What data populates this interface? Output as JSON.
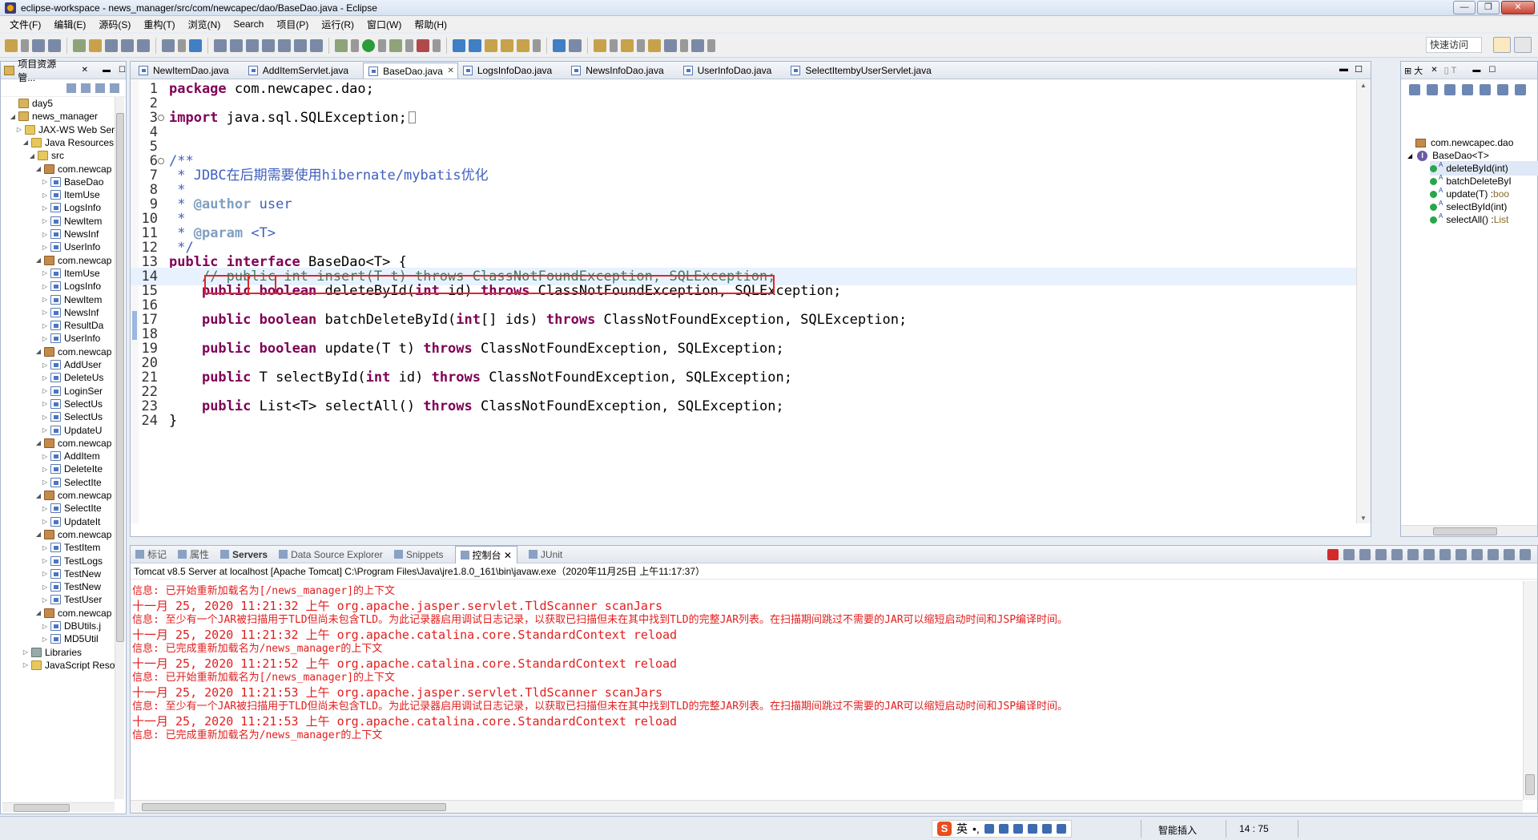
{
  "window": {
    "title": "eclipse-workspace - news_manager/src/com/newcapec/dao/BaseDao.java - Eclipse",
    "controls": [
      "—",
      "❐",
      "✕"
    ]
  },
  "menu": [
    "文件(F)",
    "编辑(E)",
    "源码(S)",
    "重构(T)",
    "浏览(N)",
    "Search",
    "项目(P)",
    "运行(R)",
    "窗口(W)",
    "帮助(H)"
  ],
  "quick_access": "快速访问",
  "project_explorer": {
    "title": "项目资源管...",
    "nodes": [
      {
        "label": "day5",
        "icon": "project-icon",
        "twisty": ""
      },
      {
        "label": "news_manager",
        "icon": "project-icon",
        "twisty": "◢"
      },
      {
        "label": "JAX-WS Web Serv",
        "icon": "folder-icon",
        "twisty": "▷"
      },
      {
        "label": "Java Resources",
        "icon": "folder-icon",
        "twisty": "◢"
      },
      {
        "label": "src",
        "icon": "folder-icon",
        "twisty": "◢"
      },
      {
        "label": "com.newcap",
        "icon": "package-icon",
        "twisty": "◢"
      },
      {
        "label": "BaseDao",
        "icon": "java-file-icon",
        "twisty": "▷"
      },
      {
        "label": "ItemUse",
        "icon": "java-file-icon",
        "twisty": "▷"
      },
      {
        "label": "LogsInfo",
        "icon": "java-file-icon",
        "twisty": "▷"
      },
      {
        "label": "NewItem",
        "icon": "java-file-icon",
        "twisty": "▷"
      },
      {
        "label": "NewsInf",
        "icon": "java-file-icon",
        "twisty": "▷"
      },
      {
        "label": "UserInfo",
        "icon": "java-file-icon",
        "twisty": "▷"
      },
      {
        "label": "com.newcap",
        "icon": "package-icon",
        "twisty": "◢"
      },
      {
        "label": "ItemUse",
        "icon": "java-file-icon",
        "twisty": "▷"
      },
      {
        "label": "LogsInfo",
        "icon": "java-file-icon",
        "twisty": "▷"
      },
      {
        "label": "NewItem",
        "icon": "java-file-icon",
        "twisty": "▷"
      },
      {
        "label": "NewsInf",
        "icon": "java-file-icon",
        "twisty": "▷"
      },
      {
        "label": "ResultDa",
        "icon": "java-file-icon",
        "twisty": "▷"
      },
      {
        "label": "UserInfo",
        "icon": "java-file-icon",
        "twisty": "▷"
      },
      {
        "label": "com.newcap",
        "icon": "package-icon",
        "twisty": "◢"
      },
      {
        "label": "AddUser",
        "icon": "java-file-icon",
        "twisty": "▷"
      },
      {
        "label": "DeleteUs",
        "icon": "java-file-icon",
        "twisty": "▷"
      },
      {
        "label": "LoginSer",
        "icon": "java-file-icon",
        "twisty": "▷"
      },
      {
        "label": "SelectUs",
        "icon": "java-file-icon",
        "twisty": "▷"
      },
      {
        "label": "SelectUs",
        "icon": "java-file-icon",
        "twisty": "▷"
      },
      {
        "label": "UpdateU",
        "icon": "java-file-icon",
        "twisty": "▷"
      },
      {
        "label": "com.newcap",
        "icon": "package-icon",
        "twisty": "◢"
      },
      {
        "label": "AddItem",
        "icon": "java-file-icon",
        "twisty": "▷"
      },
      {
        "label": "DeleteIte",
        "icon": "java-file-icon",
        "twisty": "▷"
      },
      {
        "label": "SelectIte",
        "icon": "java-file-icon",
        "twisty": "▷"
      },
      {
        "label": "com.newcap",
        "icon": "package-icon",
        "twisty": "◢"
      },
      {
        "label": "SelectIte",
        "icon": "java-file-icon",
        "twisty": "▷"
      },
      {
        "label": "UpdateIt",
        "icon": "java-file-icon",
        "twisty": "▷"
      },
      {
        "label": "com.newcap",
        "icon": "package-icon",
        "twisty": "◢"
      },
      {
        "label": "TestItem",
        "icon": "java-file-icon",
        "twisty": "▷"
      },
      {
        "label": "TestLogs",
        "icon": "java-file-icon",
        "twisty": "▷"
      },
      {
        "label": "TestNew",
        "icon": "java-file-icon",
        "twisty": "▷"
      },
      {
        "label": "TestNew",
        "icon": "java-file-icon",
        "twisty": "▷"
      },
      {
        "label": "TestUser",
        "icon": "java-file-icon",
        "twisty": "▷"
      },
      {
        "label": "com.newcap",
        "icon": "package-icon",
        "twisty": "◢"
      },
      {
        "label": "DBUtils.j",
        "icon": "java-file-icon",
        "twisty": "▷"
      },
      {
        "label": "MD5Util",
        "icon": "java-file-icon",
        "twisty": "▷"
      },
      {
        "label": "Libraries",
        "icon": "library-icon",
        "twisty": "▷"
      },
      {
        "label": "JavaScript Resour",
        "icon": "folder-icon",
        "twisty": "▷"
      }
    ]
  },
  "editor": {
    "tabs": [
      {
        "label": "NewItemDao.java",
        "active": false
      },
      {
        "label": "AddItemServlet.java",
        "active": false
      },
      {
        "label": "BaseDao.java",
        "active": true
      },
      {
        "label": "LogsInfoDao.java",
        "active": false
      },
      {
        "label": "NewsInfoDao.java",
        "active": false
      },
      {
        "label": "UserInfoDao.java",
        "active": false
      },
      {
        "label": "SelectItembyUserServlet.java",
        "active": false
      }
    ],
    "current_line": 14,
    "lines": [
      {
        "n": "1",
        "html": "<span class=\"kw\">package</span> com.newcapec.dao;"
      },
      {
        "n": "2",
        "html": ""
      },
      {
        "n": "3",
        "fold": true,
        "html": "<span class=\"kw\">import</span> java.sql.SQLException;<span style=\"display:inline-block;width:9px;height:15px;border:1px solid #888;vertical-align:-2px;margin-left:2px\"></span>"
      },
      {
        "n": "4",
        "html": ""
      },
      {
        "n": "5",
        "html": ""
      },
      {
        "n": "6",
        "fold": true,
        "html": "<span class=\"jd\">/**</span>"
      },
      {
        "n": "7",
        "html": "<span class=\"jd\"> * JDBC在后期需要使用hibernate/mybatis优化</span>"
      },
      {
        "n": "8",
        "html": "<span class=\"jd\"> *</span>"
      },
      {
        "n": "9",
        "html": "<span class=\"jd\"> * </span><span class=\"tag\">@author</span><span class=\"jd\"> user</span>"
      },
      {
        "n": "10",
        "html": "<span class=\"jd\"> *</span>"
      },
      {
        "n": "11",
        "html": "<span class=\"jd\"> * </span><span class=\"tag\">@param</span><span class=\"jd\"> &lt;T&gt;</span>"
      },
      {
        "n": "12",
        "html": "<span class=\"jd\"> */</span>"
      },
      {
        "n": "13",
        "html": "<span class=\"kw\">public</span> <span class=\"kw\">interface</span> BaseDao&lt;T&gt; {"
      },
      {
        "n": "14",
        "html": "    <span class=\"cm\">// public int insert(T t) throws ClassNotFoundException, SQLException;</span>"
      },
      {
        "n": "15",
        "html": "    <span class=\"kw\">public</span> <span class=\"kw\">boolean</span> deleteById(<span class=\"kw\">int</span> id) <span class=\"kw\">throws</span> ClassNotFoundException, SQLException;"
      },
      {
        "n": "16",
        "html": ""
      },
      {
        "n": "17",
        "html": "    <span class=\"kw\">public</span> <span class=\"kw\">boolean</span> batchDeleteById(<span class=\"kw\">int</span>[] ids) <span class=\"kw\">throws</span> ClassNotFoundException, SQLException;"
      },
      {
        "n": "18",
        "html": ""
      },
      {
        "n": "19",
        "html": "    <span class=\"kw\">public</span> <span class=\"kw\">boolean</span> update(T t) <span class=\"kw\">throws</span> ClassNotFoundException, SQLException;"
      },
      {
        "n": "20",
        "html": ""
      },
      {
        "n": "21",
        "html": "    <span class=\"kw\">public</span> T selectById(<span class=\"kw\">int</span> id) <span class=\"kw\">throws</span> ClassNotFoundException, SQLException;"
      },
      {
        "n": "22",
        "html": ""
      },
      {
        "n": "23",
        "html": "    <span class=\"kw\">public</span> List&lt;T&gt; selectAll() <span class=\"kw\">throws</span> ClassNotFoundException, SQLException;"
      },
      {
        "n": "24",
        "html": "}"
      }
    ]
  },
  "outline": {
    "items": [
      {
        "kind": "package",
        "label": "com.newcapec.dao",
        "type": ""
      },
      {
        "kind": "interface",
        "label": "BaseDao<T>",
        "type": ""
      },
      {
        "kind": "method",
        "label": "deleteById(int)",
        "type": ""
      },
      {
        "kind": "method",
        "label": "batchDeleteByI",
        "type": ""
      },
      {
        "kind": "method",
        "label": "update(T) : ",
        "type": "boo"
      },
      {
        "kind": "method",
        "label": "selectById(int)",
        "type": ""
      },
      {
        "kind": "method",
        "label": "selectAll() : ",
        "type": "List"
      }
    ]
  },
  "console": {
    "tabs": [
      {
        "label": "标记",
        "active": false,
        "bold": false
      },
      {
        "label": "属性",
        "active": false,
        "bold": false
      },
      {
        "label": "Servers",
        "active": false,
        "bold": true
      },
      {
        "label": "Data Source Explorer",
        "active": false,
        "bold": false
      },
      {
        "label": "Snippets",
        "active": false,
        "bold": false
      },
      {
        "label": "控制台 ✕",
        "active": true,
        "bold": false
      },
      {
        "label": "JUnit",
        "active": false,
        "bold": false
      }
    ],
    "process": "Tomcat v8.5 Server at localhost [Apache Tomcat] C:\\Program Files\\Java\\jre1.8.0_161\\bin\\javaw.exe（2020年11月25日 上午11:17:37）",
    "lines": [
      {
        "text": "信息: 已开始重新加载名为[/news_manager]的上下文",
        "info": true
      },
      {
        "text": "十一月 25, 2020 11:21:32 上午 org.apache.jasper.servlet.TldScanner scanJars",
        "info": false
      },
      {
        "text": "信息: 至少有一个JAR被扫描用于TLD但尚未包含TLD。为此记录器启用调试日志记录，以获取已扫描但未在其中找到TLD的完整JAR列表。在扫描期间跳过不需要的JAR可以缩短启动时间和JSP编译时间。",
        "info": true
      },
      {
        "text": "十一月 25, 2020 11:21:32 上午 org.apache.catalina.core.StandardContext reload",
        "info": false
      },
      {
        "text": "信息: 已完成重新加载名为/news_manager的上下文",
        "info": true
      },
      {
        "text": "十一月 25, 2020 11:21:52 上午 org.apache.catalina.core.StandardContext reload",
        "info": false
      },
      {
        "text": "信息: 已开始重新加载名为[/news_manager]的上下文",
        "info": true
      },
      {
        "text": "十一月 25, 2020 11:21:53 上午 org.apache.jasper.servlet.TldScanner scanJars",
        "info": false
      },
      {
        "text": "信息: 至少有一个JAR被扫描用于TLD但尚未包含TLD。为此记录器启用调试日志记录，以获取已扫描但未在其中找到TLD的完整JAR列表。在扫描期间跳过不需要的JAR可以缩短启动时间和JSP编译时间。",
        "info": true
      },
      {
        "text": "十一月 25, 2020 11:21:53 上午 org.apache.catalina.core.StandardContext reload",
        "info": false
      },
      {
        "text": "信息: 已完成重新加载名为/news_manager的上下文",
        "info": true
      }
    ]
  },
  "statusbar": {
    "ime_s": "S",
    "ime_lang": "英",
    "ime_punct": "•,",
    "insert_mode": "智能插入",
    "cursor_pos": "14 : 75"
  },
  "colors": {
    "keyword": "#7f0055",
    "comment": "#3f7f5f",
    "javadoc": "#3f5fbf",
    "console_error": "#e21e1e",
    "highlight_box": "#e0262a"
  }
}
